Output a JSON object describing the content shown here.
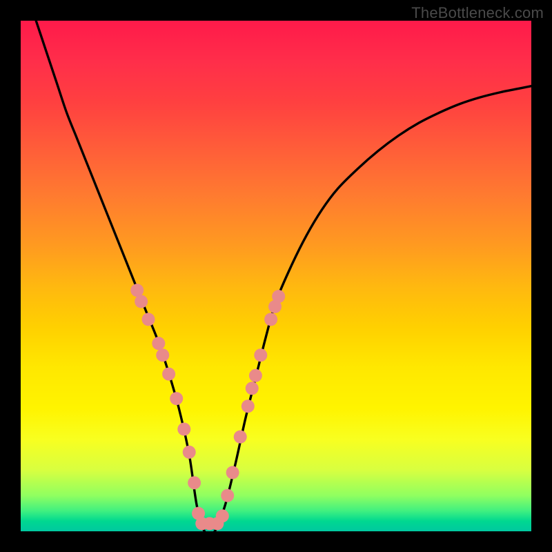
{
  "watermark": "TheBottleneck.com",
  "chart_data": {
    "type": "line",
    "title": "",
    "xlabel": "",
    "ylabel": "",
    "xlim": [
      0,
      100
    ],
    "ylim": [
      0,
      100
    ],
    "series": [
      {
        "name": "bottleneck-curve",
        "x": [
          3,
          5,
          7,
          9,
          11,
          13,
          15,
          17,
          19,
          21,
          23,
          25,
          27,
          29,
          31,
          33,
          34.5,
          36,
          38,
          40,
          42,
          44,
          46,
          48,
          50,
          53,
          56,
          59,
          62,
          66,
          70,
          74,
          78,
          82,
          86,
          90,
          94,
          98,
          100
        ],
        "values": [
          100,
          94,
          88,
          82,
          77,
          72,
          67,
          62,
          57,
          52,
          47,
          42,
          37,
          31,
          24,
          15,
          5,
          0,
          0,
          5,
          13,
          22,
          30,
          38,
          45,
          52,
          58,
          63,
          67,
          71,
          74.5,
          77.5,
          80,
          82,
          83.7,
          85,
          86,
          86.8,
          87.2
        ]
      }
    ],
    "markers": [
      {
        "x": 22.8,
        "y": 47.2
      },
      {
        "x": 23.6,
        "y": 45.0
      },
      {
        "x": 25.0,
        "y": 41.5
      },
      {
        "x": 27.0,
        "y": 36.8
      },
      {
        "x": 27.8,
        "y": 34.5
      },
      {
        "x": 29.0,
        "y": 30.8
      },
      {
        "x": 30.5,
        "y": 26.0
      },
      {
        "x": 32.0,
        "y": 20.0
      },
      {
        "x": 33.0,
        "y": 15.5
      },
      {
        "x": 34.0,
        "y": 9.5
      },
      {
        "x": 34.8,
        "y": 3.5
      },
      {
        "x": 35.5,
        "y": 1.5
      },
      {
        "x": 37.0,
        "y": 1.5
      },
      {
        "x": 38.5,
        "y": 1.5
      },
      {
        "x": 39.5,
        "y": 3.0
      },
      {
        "x": 40.5,
        "y": 7.0
      },
      {
        "x": 41.5,
        "y": 11.5
      },
      {
        "x": 43.0,
        "y": 18.5
      },
      {
        "x": 44.5,
        "y": 24.5
      },
      {
        "x": 45.3,
        "y": 28.0
      },
      {
        "x": 46.0,
        "y": 30.5
      },
      {
        "x": 47.0,
        "y": 34.5
      },
      {
        "x": 49.0,
        "y": 41.5
      },
      {
        "x": 49.8,
        "y": 44.0
      },
      {
        "x": 50.5,
        "y": 46.0
      }
    ],
    "gradient_stops": [
      {
        "pos": 0,
        "color": "#ff1a4a"
      },
      {
        "pos": 50,
        "color": "#ffd000"
      },
      {
        "pos": 100,
        "color": "#00c8a0"
      }
    ]
  }
}
